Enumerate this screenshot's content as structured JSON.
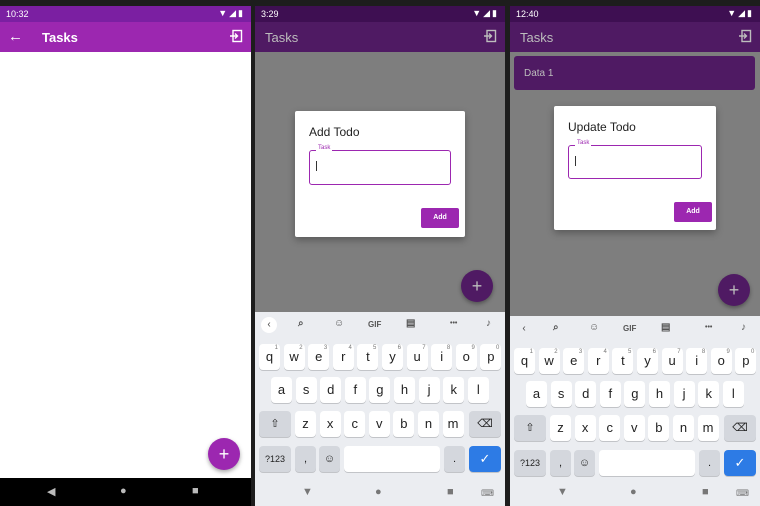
{
  "screens": [
    {
      "status": {
        "time": "10:32",
        "icons": "▼◢▮"
      },
      "appbar": {
        "title": "Tasks",
        "back_icon": "arrow-back-icon",
        "exit_icon": "exit-icon"
      },
      "fab": {
        "label": "+"
      },
      "navbar": {
        "back": "◀",
        "home": "●",
        "recents": "■"
      }
    },
    {
      "status": {
        "time": "3:29",
        "icons": "▼◢▮"
      },
      "appbar": {
        "title": "Tasks",
        "exit_icon": "exit-icon"
      },
      "dialog": {
        "title": "Add Todo",
        "field_label": "Task",
        "field_value": "",
        "button_label": "Add"
      },
      "fab": {
        "label": "+"
      }
    },
    {
      "status": {
        "time": "12:40",
        "icons": "▼◢▮"
      },
      "appbar": {
        "title": "Tasks",
        "exit_icon": "exit-icon"
      },
      "list": [
        {
          "label": "Data 1"
        }
      ],
      "dialog": {
        "title": "Update Todo",
        "field_label": "Task",
        "field_value": "",
        "button_label": "Add"
      },
      "fab": {
        "label": "+"
      }
    }
  ],
  "keyboard": {
    "toolbar": {
      "back": "‹",
      "search": "🔍",
      "sticker": "☺",
      "gif": "GIF",
      "clipboard": "📋",
      "more": "•••",
      "mic": "🎤"
    },
    "row1": [
      "q",
      "w",
      "e",
      "r",
      "t",
      "y",
      "u",
      "i",
      "o",
      "p"
    ],
    "row1_hints": [
      "1",
      "2",
      "3",
      "4",
      "5",
      "6",
      "7",
      "8",
      "9",
      "0"
    ],
    "row2": [
      "a",
      "s",
      "d",
      "f",
      "g",
      "h",
      "j",
      "k",
      "l"
    ],
    "row3": [
      "z",
      "x",
      "c",
      "v",
      "b",
      "n",
      "m"
    ],
    "shift": "⇧",
    "backspace": "⌫",
    "sym": "?123",
    "comma": ",",
    "emoji": "☺",
    "period": ".",
    "enter": "✓",
    "nav": {
      "back": "▼",
      "home": "●",
      "recents": "■",
      "keyboard": "⌨"
    }
  },
  "colors": {
    "primary": "#9c27b0",
    "primary_dark": "#7b1fa2",
    "scrim_appbar": "#4f1a63",
    "enter_key": "#2d7be5"
  }
}
